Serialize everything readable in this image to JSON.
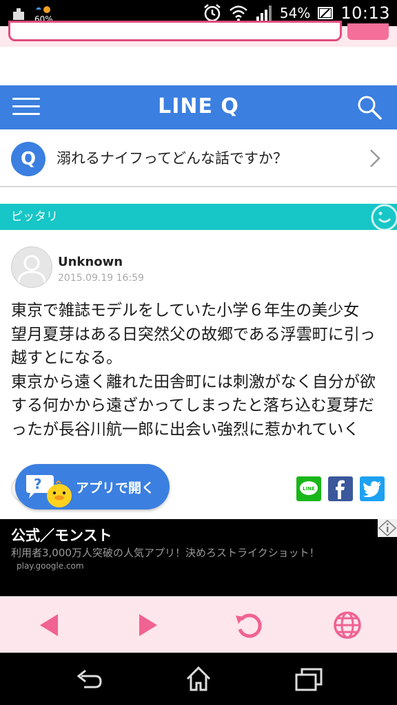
{
  "status_bar": {
    "battery_small": "60%",
    "battery_percent": "54%",
    "time": "10:13"
  },
  "header": {
    "logo": "LINE Q"
  },
  "question": {
    "badge": "Q",
    "text": "溺れるナイフってどんな話ですか？"
  },
  "category": {
    "label": "ピッタリ"
  },
  "answer": {
    "user_name": "Unknown",
    "timestamp": "2015.09.19 16:59",
    "body": "東京で雑誌モデルをしていた小学６年生の美少女\n望月夏芽はある日突然父の故郷である浮雲町に引っ越すとになる。\n東京から遠く離れた田舎町には刺激がなく自分が欲する何かから遠ざかってしまったと落ち込む夏芽だったが長谷川航一郎に出会い強烈に惹かれていく"
  },
  "app_open": {
    "label": "アプリで開く"
  },
  "share": {
    "line_label": "LINE"
  },
  "ad": {
    "title": "公式／モンスト",
    "description": "利用者3,000万人突破の人気アプリ！決めろストライクショット！",
    "source": "play.google.com"
  },
  "colors": {
    "header_blue": "#3b7fe0",
    "category_teal": "#17c6c6",
    "browser_pink": "#f06292",
    "line_green": "#19b719",
    "facebook_blue": "#3a589b",
    "twitter_blue": "#1da1f2"
  }
}
